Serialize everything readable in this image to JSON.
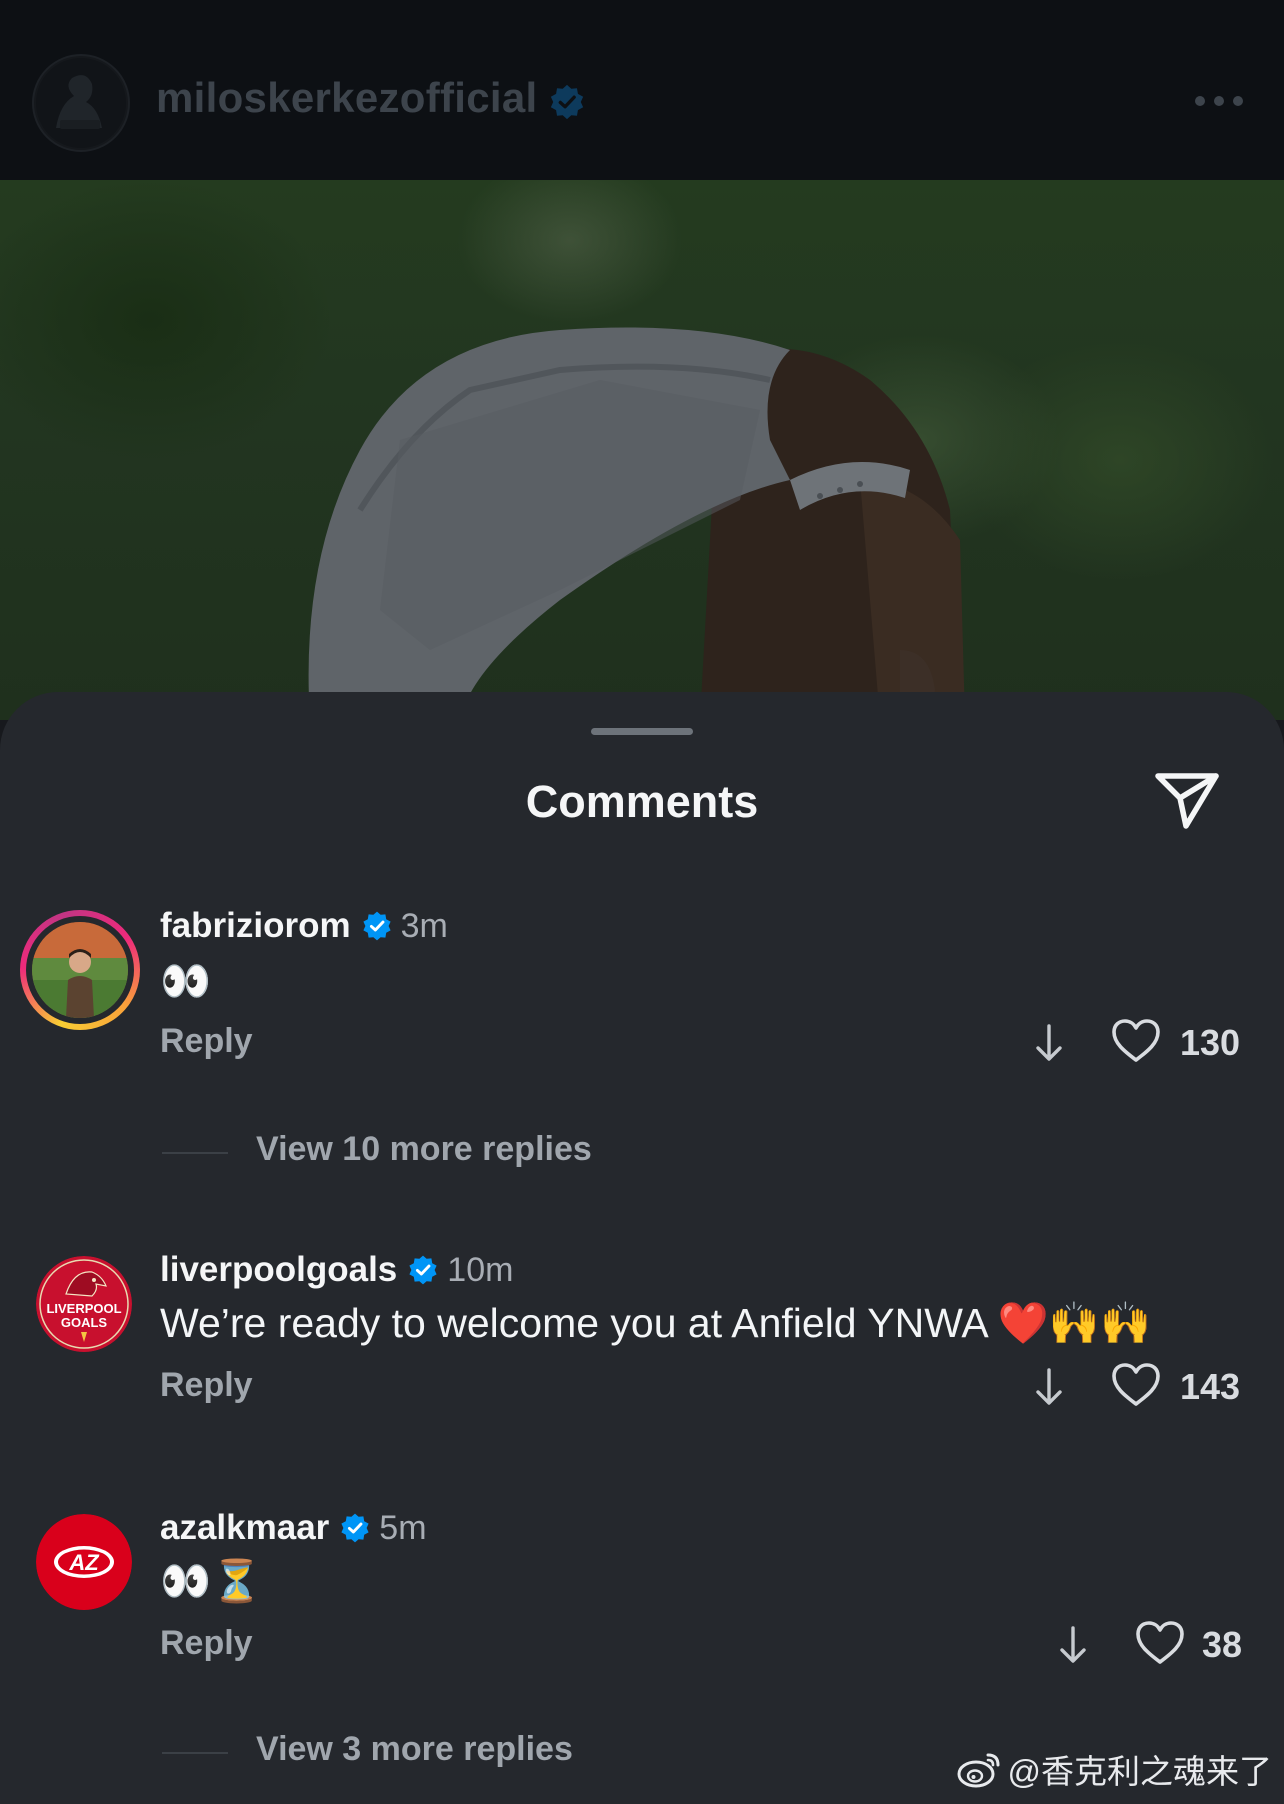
{
  "header": {
    "username": "miloskerkezofficial",
    "verified_icon": "verified-badge-icon",
    "more_icon": "more-options-icon"
  },
  "sheet": {
    "title": "Comments",
    "share_icon": "paper-plane-share-icon"
  },
  "comments": [
    {
      "username": "fabriziorom",
      "time": "3m",
      "text": "👀",
      "reply_label": "Reply",
      "likes": "130",
      "view_replies": "View 10 more replies",
      "has_story_ring": true
    },
    {
      "username": "liverpoolgoals",
      "time": "10m",
      "text": "We’re ready to welcome you at Anfield YNWA ❤️🙌🙌",
      "reply_label": "Reply",
      "likes": "143",
      "avatar_text": "LIVERPOOL GOALS"
    },
    {
      "username": "azalkmaar",
      "time": "5m",
      "text": "👀⏳",
      "reply_label": "Reply",
      "likes": "38",
      "view_replies": "View 3 more replies",
      "avatar_text": "AZ"
    }
  ],
  "watermark": {
    "text": "@香克利之魂来了"
  },
  "colors": {
    "sheet_bg": "#25282d",
    "verified": "#0095f6",
    "secondary_text": "#a0a6ad"
  }
}
